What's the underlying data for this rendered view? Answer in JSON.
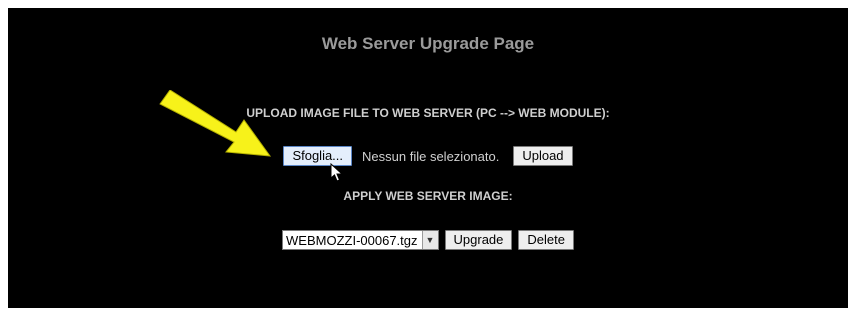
{
  "page": {
    "title": "Web Server Upgrade Page"
  },
  "upload": {
    "section_label": "UPLOAD IMAGE FILE TO WEB SERVER (PC --> WEB MODULE):",
    "browse_label": "Sfoglia...",
    "file_status": "Nessun file selezionato.",
    "upload_label": "Upload"
  },
  "apply": {
    "section_label": "APPLY WEB SERVER IMAGE:",
    "selected_image": "WEBMOZZI-00067.tgz",
    "upgrade_label": "Upgrade",
    "delete_label": "Delete"
  },
  "icons": {
    "annotation": "yellow-arrow-icon",
    "cursor": "mouse-pointer-icon",
    "dropdown": "chevron-down-icon"
  },
  "colors": {
    "background": "#000000",
    "annotation_arrow": "#f7f21a"
  }
}
